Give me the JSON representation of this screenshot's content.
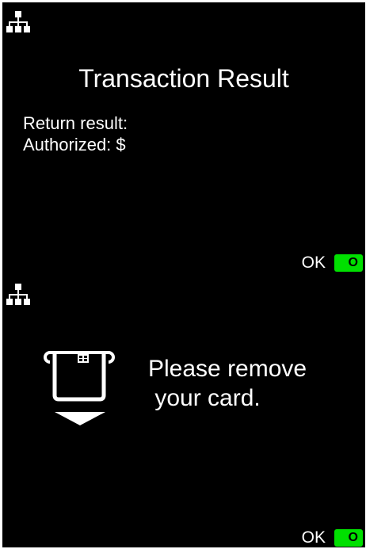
{
  "screen1": {
    "icon": "network-icon",
    "title": "Transaction Result",
    "lines": [
      "Return result:",
      "Authorized: $"
    ],
    "ok_label": "OK",
    "ok_key": "O",
    "ok_key_color": "#00e000"
  },
  "screen2": {
    "icon": "network-icon",
    "card_icon": "remove-card-icon",
    "message_lines": [
      "Please remove",
      " your card."
    ],
    "ok_label": "OK",
    "ok_key": "O",
    "ok_key_color": "#00e000"
  }
}
